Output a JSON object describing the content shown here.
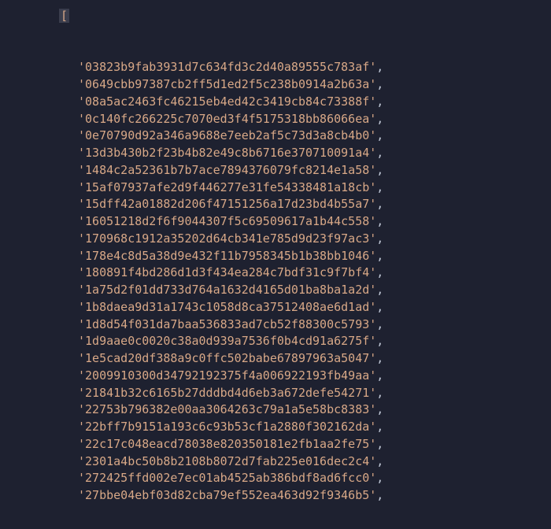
{
  "bracket": "[",
  "hashes": [
    "03823b9fab3931d7c634fd3c2d40a89555c783af",
    "0649cbb97387cb2ff5d1ed2f5c238b0914a2b63a",
    "08a5ac2463fc46215eb4ed42c3419cb84c73388f",
    "0c140fc266225c7070ed3f4f5175318bb86066ea",
    "0e70790d92a346a9688e7eeb2af5c73d3a8cb4b0",
    "13d3b430b2f23b4b82e49c8b6716e370710091a4",
    "1484c2a52361b7b7ace7894376079fc8214e1a58",
    "15af07937afe2d9f446277e31fe54338481a18cb",
    "15dff42a01882d206f47151256a17d23bd4b55a7",
    "16051218d2f6f9044307f5c69509617a1b44c558",
    "170968c1912a35202d64cb341e785d9d23f97ac3",
    "178e4c8d5a38d9e432f11b7958345b1b38bb1046",
    "180891f4bd286d1d3f434ea284c7bdf31c9f7bf4",
    "1a75d2f01dd733d764a1632d4165d01ba8ba1a2d",
    "1b8daea9d31a1743c1058d8ca37512408ae6d1ad",
    "1d8d54f031da7baa536833ad7cb52f88300c5793",
    "1d9aae0c0020c38a0d939a7536f0b4cd91a6275f",
    "1e5cad20df388a9c0ffc502babe67897963a5047",
    "2009910300d34792192375f4a006922193fb49aa",
    "21841b32c6165b27dddbd4d6eb3a672defe54271",
    "22753b796382e00aa3064263c79a1a5e58bc8383",
    "22bff7b9151a193c6c93b53cf1a2880f302162da",
    "22c17c048eacd78038e820350181e2fb1aa2fe75",
    "2301a4bc50b8b2108b8072d7fab225e016dec2c4",
    "272425ffd002e7ec01ab4525ab386bdf8ad6fcc0",
    "27bbe04ebf03d82cba79ef552ea463d92f9346b5"
  ]
}
